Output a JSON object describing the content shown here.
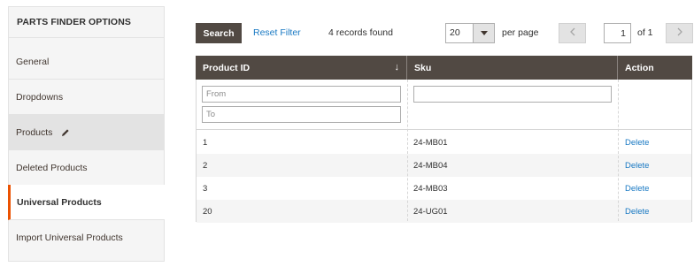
{
  "sidebar": {
    "title": "PARTS FINDER OPTIONS",
    "items": [
      {
        "label": "General"
      },
      {
        "label": "Dropdowns"
      },
      {
        "label": "Products",
        "icon": "pencil-icon"
      },
      {
        "label": "Deleted Products"
      },
      {
        "label": "Universal Products"
      },
      {
        "label": "Import Universal Products"
      }
    ]
  },
  "toolbar": {
    "search_label": "Search",
    "reset_label": "Reset Filter",
    "records_text": "4 records found",
    "per_page_value": "20",
    "per_page_label": "per page",
    "current_page": "1",
    "page_of_text": "of 1"
  },
  "grid": {
    "columns": [
      "Product ID",
      "Sku",
      "Action"
    ],
    "filters": {
      "from_placeholder": "From",
      "to_placeholder": "To",
      "sku_value": ""
    },
    "rows": [
      {
        "id": "1",
        "sku": "24-MB01",
        "action": "Delete"
      },
      {
        "id": "2",
        "sku": "24-MB04",
        "action": "Delete"
      },
      {
        "id": "3",
        "sku": "24-MB03",
        "action": "Delete"
      },
      {
        "id": "20",
        "sku": "24-UG01",
        "action": "Delete"
      }
    ]
  },
  "colors": {
    "header_bg": "#514943",
    "accent": "#eb5202",
    "link": "#1979c3",
    "sidebar_bg": "#f5f5f5"
  }
}
